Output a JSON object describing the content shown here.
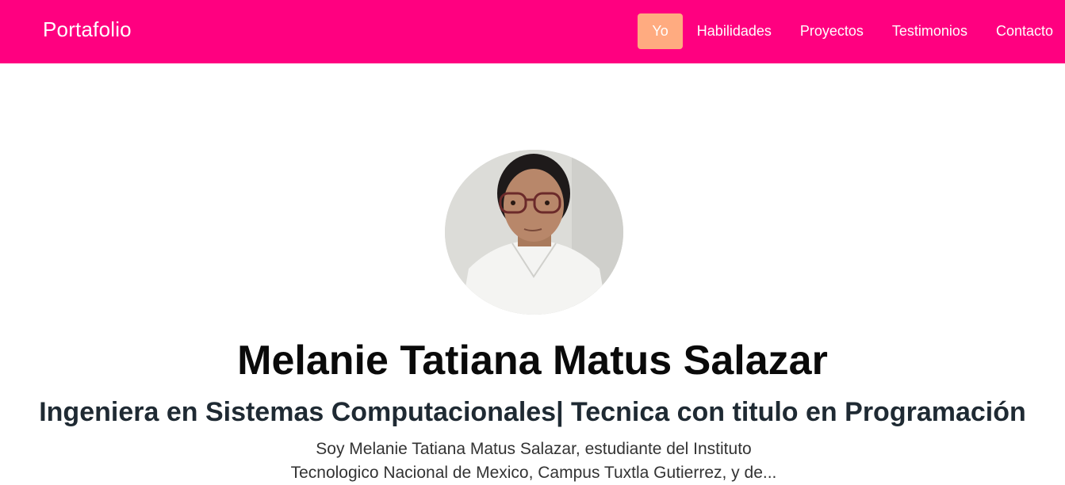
{
  "header": {
    "brand": "Portafolio",
    "nav": [
      {
        "label": "Yo",
        "active": true
      },
      {
        "label": "Habilidades",
        "active": false
      },
      {
        "label": "Proyectos",
        "active": false
      },
      {
        "label": "Testimonios",
        "active": false
      },
      {
        "label": "Contacto",
        "active": false
      }
    ]
  },
  "hero": {
    "name": "Melanie Tatiana Matus Salazar",
    "subtitle": "Ingeniera en Sistemas Computacionales| Tecnica con titulo en Programación",
    "bio": "Soy Melanie Tatiana Matus Salazar, estudiante del Instituto Tecnologico Nacional de Mexico, Campus Tuxtla Gutierrez, y de..."
  },
  "colors": {
    "navbar": "#ff0080",
    "active_nav": "#ffab80",
    "text_white": "#ffffff",
    "heading": "#0a0a0a"
  }
}
